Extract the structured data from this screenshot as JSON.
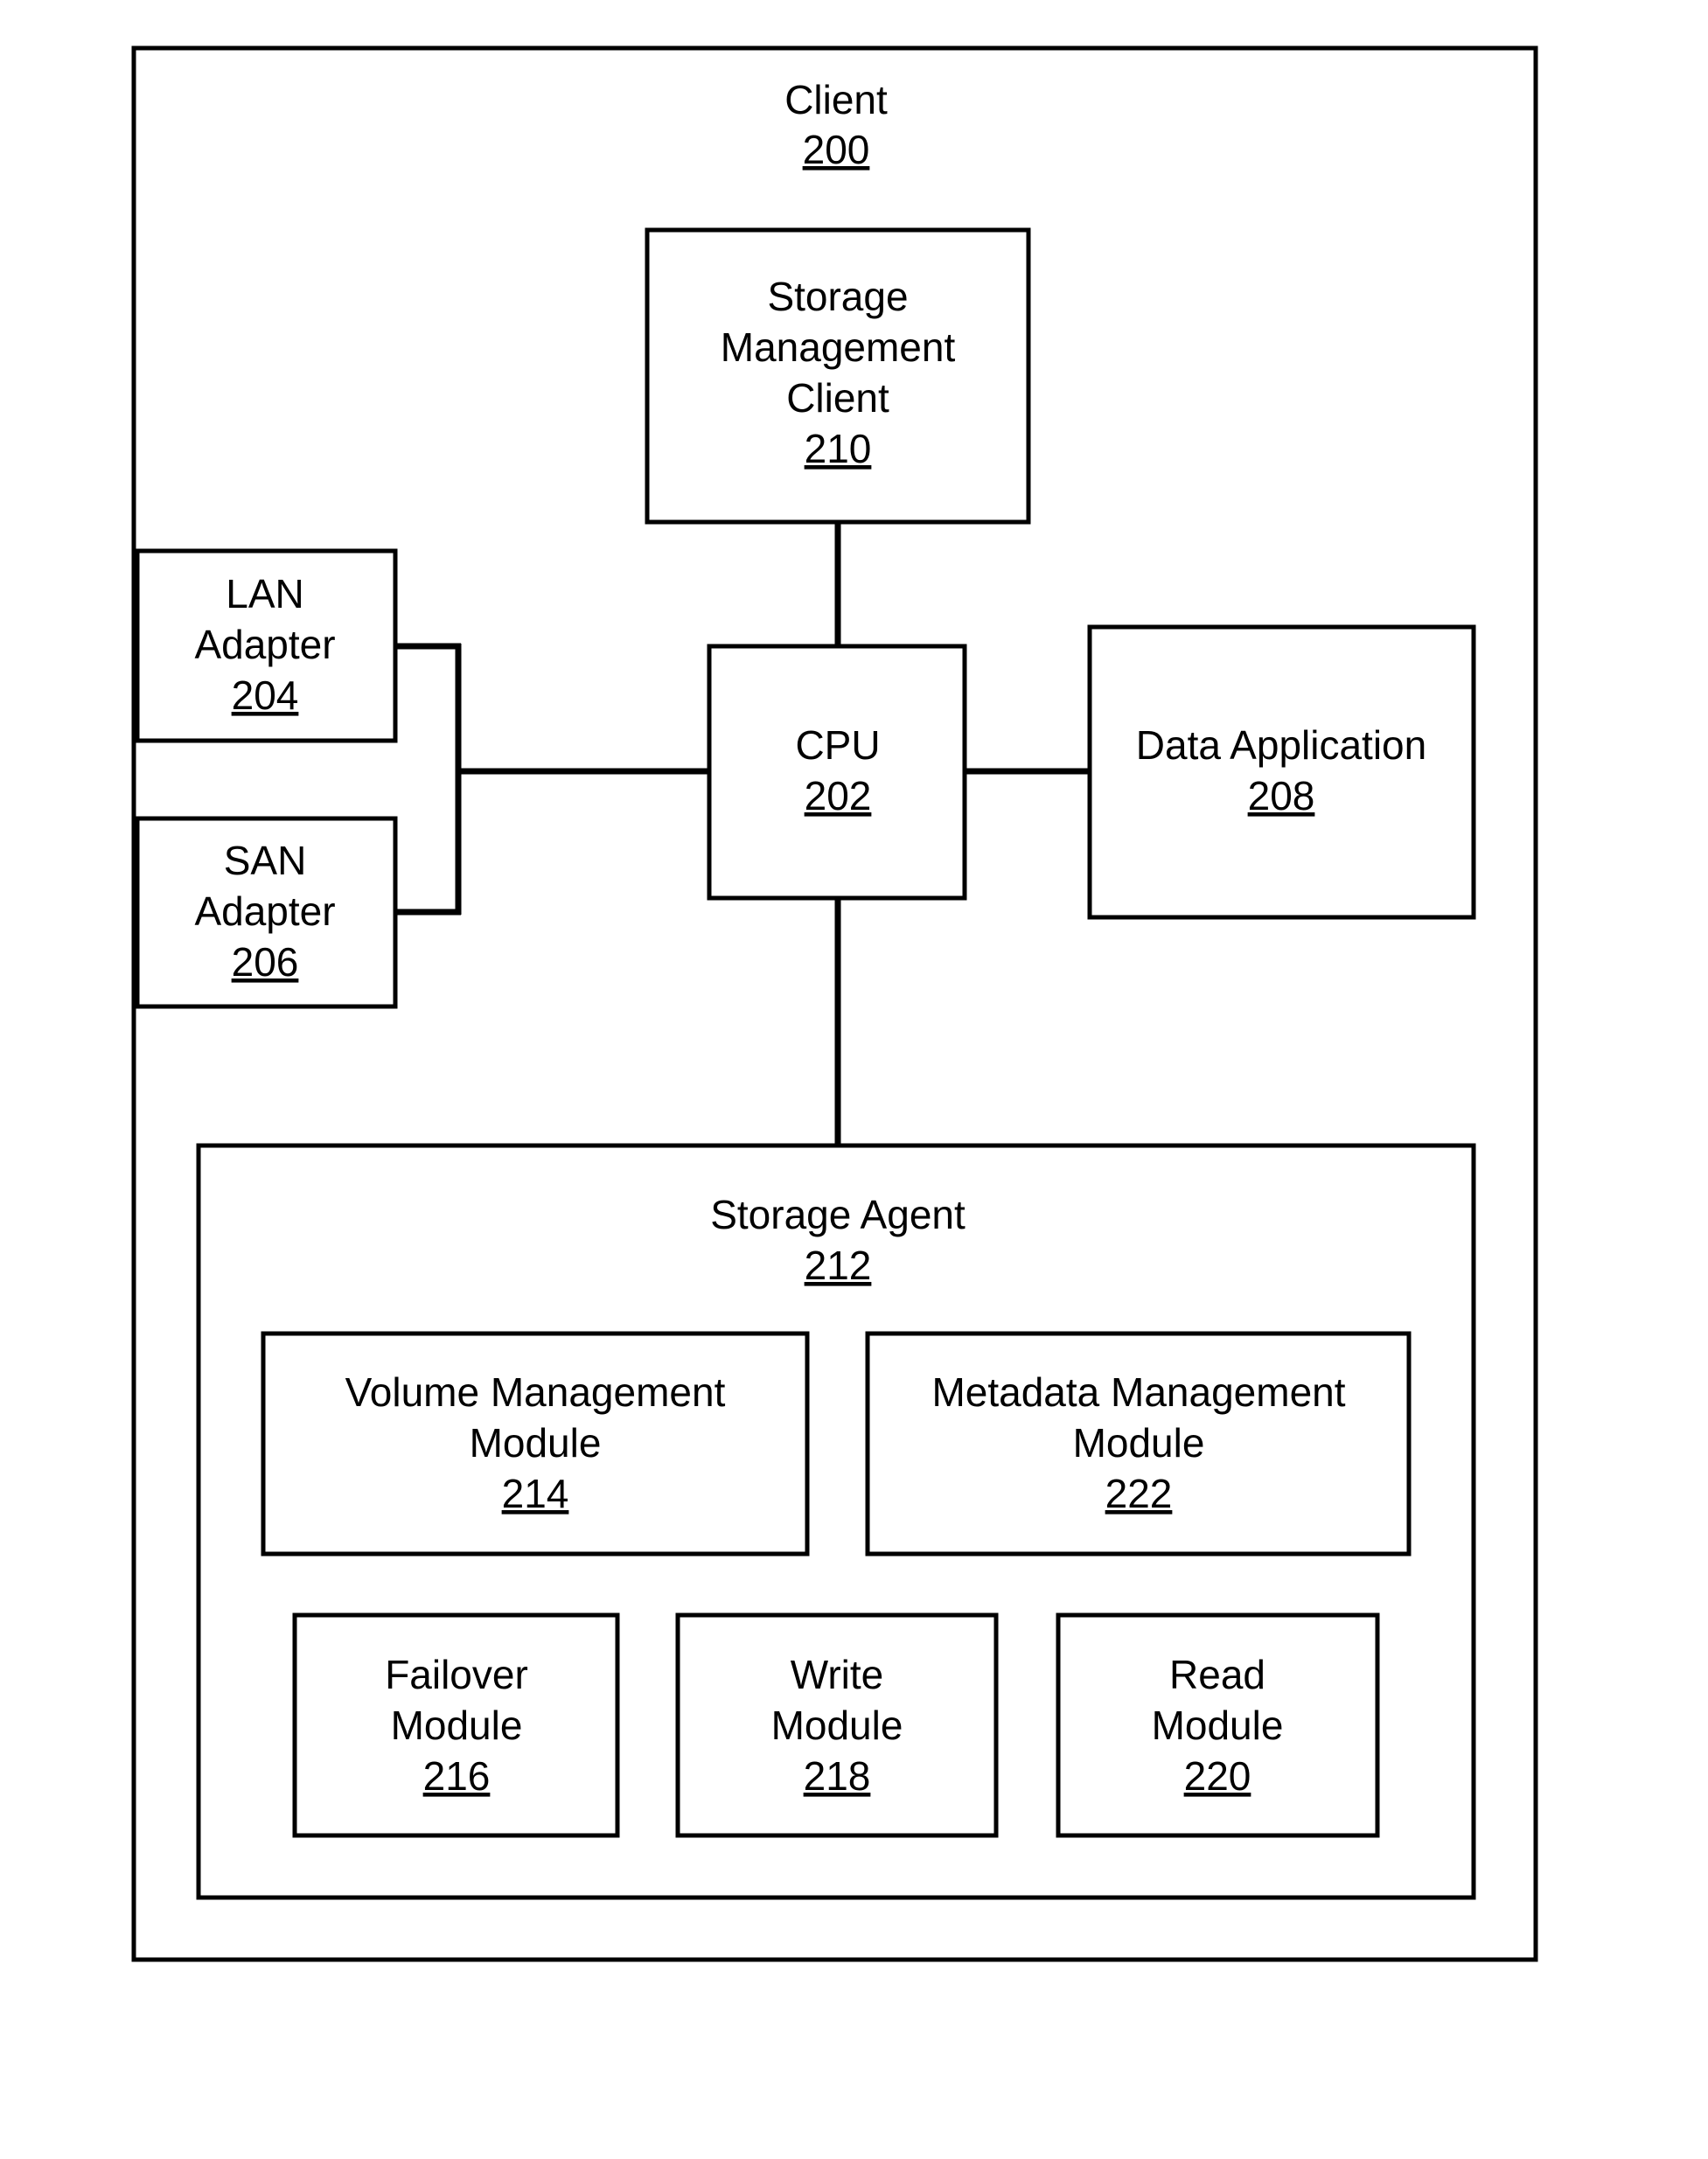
{
  "diagram": {
    "client": {
      "label": "Client",
      "ref": "200"
    },
    "storage_management_client": {
      "lines": [
        "Storage",
        "Management",
        "Client"
      ],
      "ref": "210"
    },
    "cpu": {
      "lines": [
        "CPU"
      ],
      "ref": "202"
    },
    "lan_adapter": {
      "lines": [
        "LAN",
        "Adapter"
      ],
      "ref": "204"
    },
    "san_adapter": {
      "lines": [
        "SAN",
        "Adapter"
      ],
      "ref": "206"
    },
    "data_application": {
      "lines": [
        "Data Application"
      ],
      "ref": "208"
    },
    "storage_agent": {
      "label": "Storage Agent",
      "ref": "212",
      "modules": [
        {
          "id": "volume-management-module",
          "lines": [
            "Volume Management",
            "Module"
          ],
          "ref": "214"
        },
        {
          "id": "metadata-management-module",
          "lines": [
            "Metadata Management",
            "Module"
          ],
          "ref": "222"
        },
        {
          "id": "failover-module",
          "lines": [
            "Failover",
            "Module"
          ],
          "ref": "216"
        },
        {
          "id": "write-module",
          "lines": [
            "Write",
            "Module"
          ],
          "ref": "218"
        },
        {
          "id": "read-module",
          "lines": [
            "Read",
            "Module"
          ],
          "ref": "220"
        }
      ]
    },
    "connections": [
      [
        "storage-management-client",
        "cpu"
      ],
      [
        "lan-adapter",
        "cpu"
      ],
      [
        "san-adapter",
        "cpu"
      ],
      [
        "cpu",
        "data-application"
      ],
      [
        "cpu",
        "storage-agent"
      ]
    ]
  }
}
